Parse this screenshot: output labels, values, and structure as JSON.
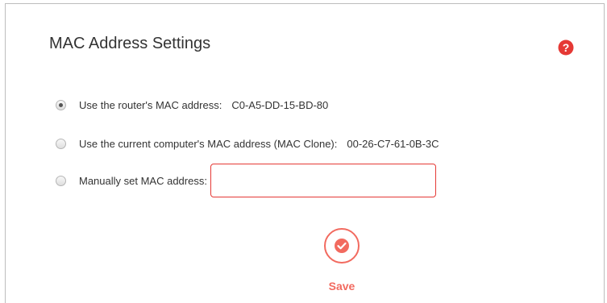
{
  "page": {
    "title": "MAC Address Settings"
  },
  "options": [
    {
      "label": "Use the router's MAC address:",
      "value": "C0-A5-DD-15-BD-80",
      "selected": true
    },
    {
      "label": "Use the current computer's MAC address (MAC Clone):",
      "value": "00-26-C7-61-0B-3C",
      "selected": false
    },
    {
      "label": "Manually set MAC address:",
      "selected": false
    }
  ],
  "manual_input": {
    "value": "",
    "placeholder": ""
  },
  "save": {
    "label": "Save"
  },
  "icons": {
    "help": "question-circle-icon",
    "save": "checkmark-circle-icon"
  },
  "colors": {
    "accent": "#f26a5f",
    "help_icon": "#e53935",
    "input_error_border": "#e53935"
  }
}
